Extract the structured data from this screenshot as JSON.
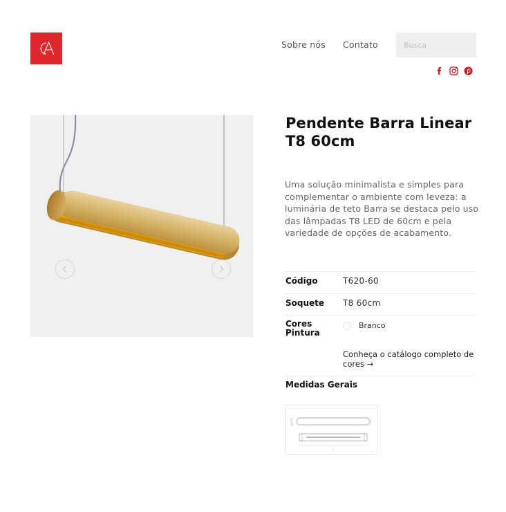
{
  "brand": {
    "logo_text": "CA",
    "brand_color": "#e0262b"
  },
  "nav": {
    "about_label": "Sobre nós",
    "contact_label": "Contato"
  },
  "search": {
    "placeholder": "Busca"
  },
  "social": {
    "icons": [
      "facebook-icon",
      "instagram-icon",
      "pinterest-icon"
    ],
    "color": "#d0121b"
  },
  "gallery": {
    "prev_icon": "chevron-left-icon",
    "next_icon": "chevron-right-icon",
    "product_finish_color": "#c9a34e"
  },
  "product": {
    "title": "Pendente Barra Linear T8 60cm",
    "description": "Uma solução minimalista e simples para complementar o ambiente com leveza: a luminária de teto Barra se destaca pelo uso das lâmpadas T8 LED de 60cm e pela variedade de opções de acabamento."
  },
  "specs": {
    "code_label": "Código",
    "code_value": "T620-60",
    "socket_label": "Soquete",
    "socket_value": "T8 60cm",
    "colors_label": "Cores Pintura",
    "colors": [
      {
        "name": "Branco",
        "hex": "#ffffff"
      }
    ],
    "catalog_link": "Conheça o catálogo completo de cores →",
    "measures_label": "Medidas Gerais"
  }
}
